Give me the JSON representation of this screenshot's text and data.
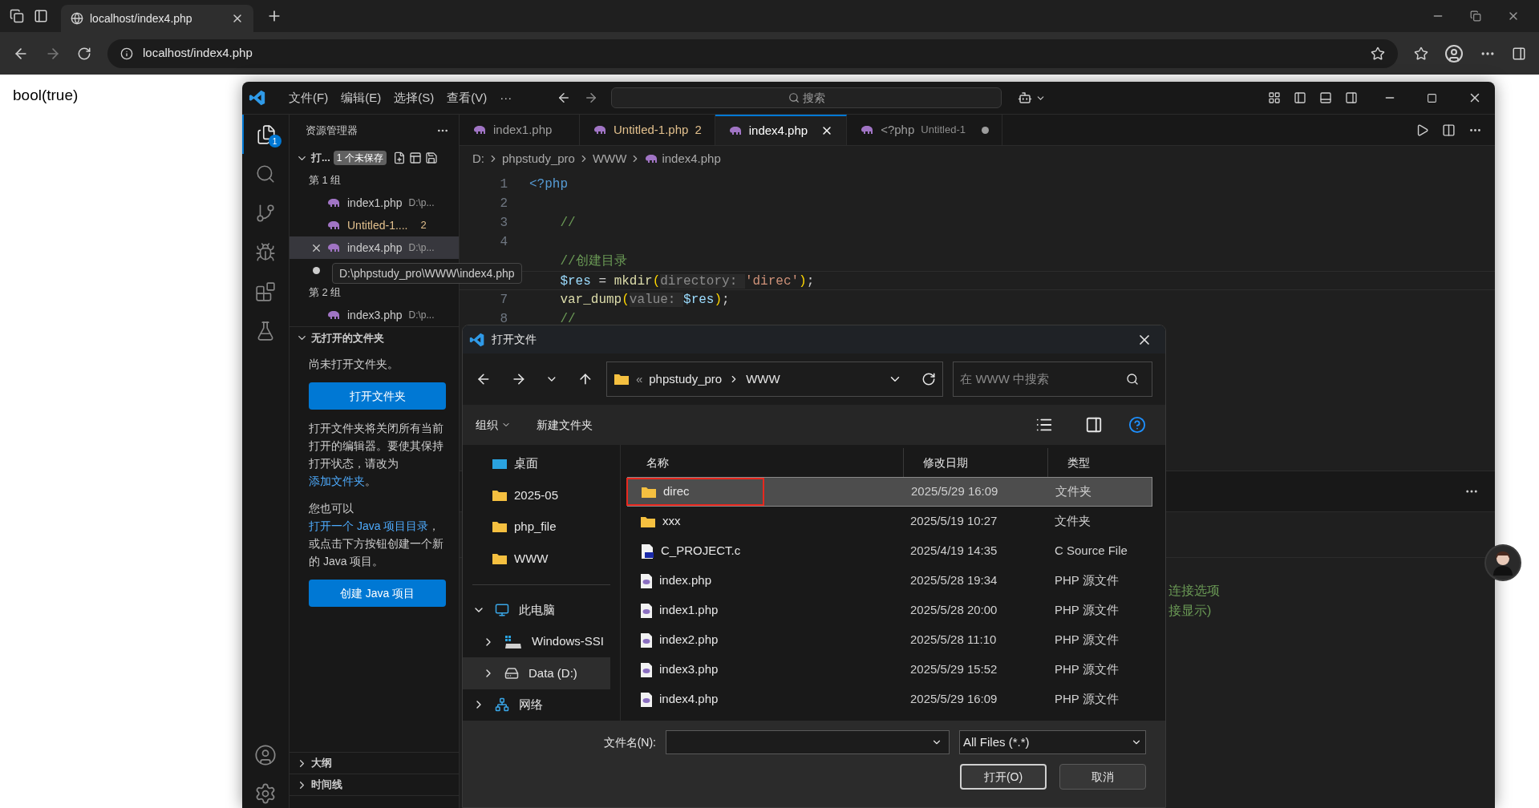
{
  "browser": {
    "tab": {
      "title": "localhost/index4.php",
      "selected": true
    },
    "address": "localhost/index4.php"
  },
  "page": {
    "output": "bool(true)"
  },
  "vscode": {
    "menu": [
      "文件(F)",
      "编辑(E)",
      "选择(S)",
      "查看(V)",
      "···"
    ],
    "search": {
      "placeholder": "搜索"
    },
    "activity": [
      {
        "kind": "files",
        "selected": true,
        "badge": "1"
      },
      {
        "kind": "search",
        "selected": false
      },
      {
        "kind": "git",
        "selected": false
      },
      {
        "kind": "debug",
        "selected": false
      },
      {
        "kind": "extensions",
        "selected": false
      },
      {
        "kind": "testing",
        "selected": false
      }
    ],
    "sidebar": {
      "title": "资源管理器",
      "open_editors": {
        "label": "打...",
        "badge": "1 个未保存",
        "expanded": true,
        "groups": [
          {
            "name": "第 1 组",
            "files": [
              {
                "name": "index1.php",
                "path": "D:\\p...",
                "selected": false,
                "dirty": false
              },
              {
                "name": "Untitled-1....",
                "badge": "2",
                "modified": true,
                "selected": false,
                "dirty": false
              },
              {
                "name": "index4.php",
                "path": "D:\\p...",
                "selected": true,
                "dirty": false
              },
              {
                "selected": false,
                "dirty": true
              }
            ]
          },
          {
            "name": "第 2 组",
            "files": [
              {
                "name": "index3.php",
                "path": "D:\\p...",
                "selected": false,
                "dirty": false
              }
            ]
          }
        ]
      },
      "folder": {
        "title": "无打开的文件夹",
        "expanded": true,
        "message": "尚未打开文件夹。",
        "open_button": "打开文件夹",
        "notes": [
          [
            {
              "text": "打开文件夹将关闭所有当前打开的编辑器。要使其保持打开状态，请改为 "
            },
            {
              "link": "添加文件夹"
            },
            {
              "text": "。"
            }
          ],
          [
            {
              "text": "您也可以"
            },
            {
              "link": "打开一个 Java 项目目录"
            },
            {
              "text": "，或点击下方按钮创建一个新的 Java 项目。"
            }
          ]
        ],
        "java_button": "创建 Java 项目"
      },
      "sections": [
        {
          "title": "大纲",
          "expanded": false
        },
        {
          "title": "时间线",
          "expanded": false
        }
      ]
    },
    "tabs": [
      {
        "label": "index1.php",
        "modified": false,
        "selected": false,
        "dirty": false
      },
      {
        "label": "Untitled-1.php",
        "badge": "2",
        "modified": true,
        "selected": false,
        "dirty": false
      },
      {
        "label": "index4.php",
        "modified": false,
        "selected": true,
        "dirty": false
      },
      {
        "label": "<?php",
        "detail": "Untitled-1",
        "modified": false,
        "selected": false,
        "dirty": true
      }
    ],
    "breadcrumb": [
      "D:",
      "phpstudy_pro",
      "WWW",
      "index4.php"
    ],
    "lines": [
      {
        "number": "1",
        "current": false,
        "tokens": [
          {
            "kind": "tag",
            "text": "<?php"
          }
        ]
      },
      {
        "number": "2",
        "current": false
      },
      {
        "number": "3",
        "current": false,
        "tokens": [
          {
            "kind": "comment",
            "text": "    //"
          }
        ]
      },
      {
        "number": "4",
        "current": false
      },
      {
        "current": false,
        "tokens": [
          {
            "kind": "comment",
            "text": "    //创建目录"
          }
        ]
      },
      {
        "current": true,
        "tokens": [
          {
            "kind": "var",
            "text": "    $res"
          },
          {
            "kind": "op",
            "text": " = "
          },
          {
            "kind": "fn",
            "text": "mkdir"
          },
          {
            "kind": "paren",
            "text": "("
          },
          {
            "kind": "hint",
            "text": "directory: "
          },
          {
            "kind": "str",
            "text": "'direc'"
          },
          {
            "kind": "paren",
            "text": ")"
          },
          {
            "kind": "op",
            "text": ";"
          }
        ]
      },
      {
        "number": "7",
        "current": false,
        "tokens": [
          {
            "kind": "fn",
            "text": "    var_dump"
          },
          {
            "kind": "paren",
            "text": "("
          },
          {
            "kind": "hint",
            "text": "value: "
          },
          {
            "kind": "var",
            "text": "$res"
          },
          {
            "kind": "paren",
            "text": ")"
          },
          {
            "kind": "op",
            "text": ";"
          }
        ]
      },
      {
        "number": "8",
        "current": false,
        "tokens": [
          {
            "kind": "comment",
            "text": "    //"
          }
        ]
      }
    ],
    "terminal": [
      "连接选项",
      "接显示)"
    ]
  },
  "tooltip": "D:\\phpstudy_pro\\WWW\\index4.php",
  "dialog": {
    "title": "打开文件",
    "path_prefix": "«",
    "path": [
      "phpstudy_pro",
      "WWW"
    ],
    "search": {
      "placeholder": "在 WWW 中搜索"
    },
    "toolbar": [
      "组织",
      "新建文件夹"
    ],
    "quick_access": [
      {
        "label": "桌面",
        "kind": "desktop"
      },
      {
        "label": "2025-05",
        "kind": "folder"
      },
      {
        "label": "php_file",
        "kind": "folder"
      },
      {
        "label": "WWW",
        "kind": "folder"
      }
    ],
    "devices": [
      {
        "label": "此电脑",
        "kind": "pc",
        "expanded": true,
        "selected": false,
        "children": [
          {
            "label": "Windows-SSI",
            "kind": "windrive",
            "expanded": false,
            "selected": false
          },
          {
            "label": "Data (D:)",
            "kind": "drive",
            "expanded": false,
            "selected": true
          }
        ]
      },
      {
        "label": "网络",
        "kind": "network",
        "expanded": false,
        "selected": false
      }
    ],
    "columns": [
      "名称",
      "修改日期",
      "类型"
    ],
    "files": [
      {
        "name": "direc",
        "date": "2025/5/29 16:09",
        "type": "文件夹",
        "kind": "folder",
        "selected": true,
        "highlighted": true
      },
      {
        "name": "xxx",
        "date": "2025/5/19 10:27",
        "type": "文件夹",
        "kind": "folder",
        "selected": false,
        "highlighted": false
      },
      {
        "name": "C_PROJECT.c",
        "date": "2025/4/19 14:35",
        "type": "C Source File",
        "kind": "c",
        "selected": false,
        "highlighted": false
      },
      {
        "name": "index.php",
        "date": "2025/5/28 19:34",
        "type": "PHP 源文件",
        "kind": "php",
        "selected": false,
        "highlighted": false
      },
      {
        "name": "index1.php",
        "date": "2025/5/28 20:00",
        "type": "PHP 源文件",
        "kind": "php",
        "selected": false,
        "highlighted": false
      },
      {
        "name": "index2.php",
        "date": "2025/5/28 11:10",
        "type": "PHP 源文件",
        "kind": "php",
        "selected": false,
        "highlighted": false
      },
      {
        "name": "index3.php",
        "date": "2025/5/29 15:52",
        "type": "PHP 源文件",
        "kind": "php",
        "selected": false,
        "highlighted": false
      },
      {
        "name": "index4.php",
        "date": "2025/5/29 16:09",
        "type": "PHP 源文件",
        "kind": "php",
        "selected": false,
        "highlighted": false
      }
    ],
    "filename": {
      "label": "文件名(N):"
    },
    "filter": "All Files (*.*)",
    "buttons": [
      "打开(O)",
      "取消"
    ]
  }
}
